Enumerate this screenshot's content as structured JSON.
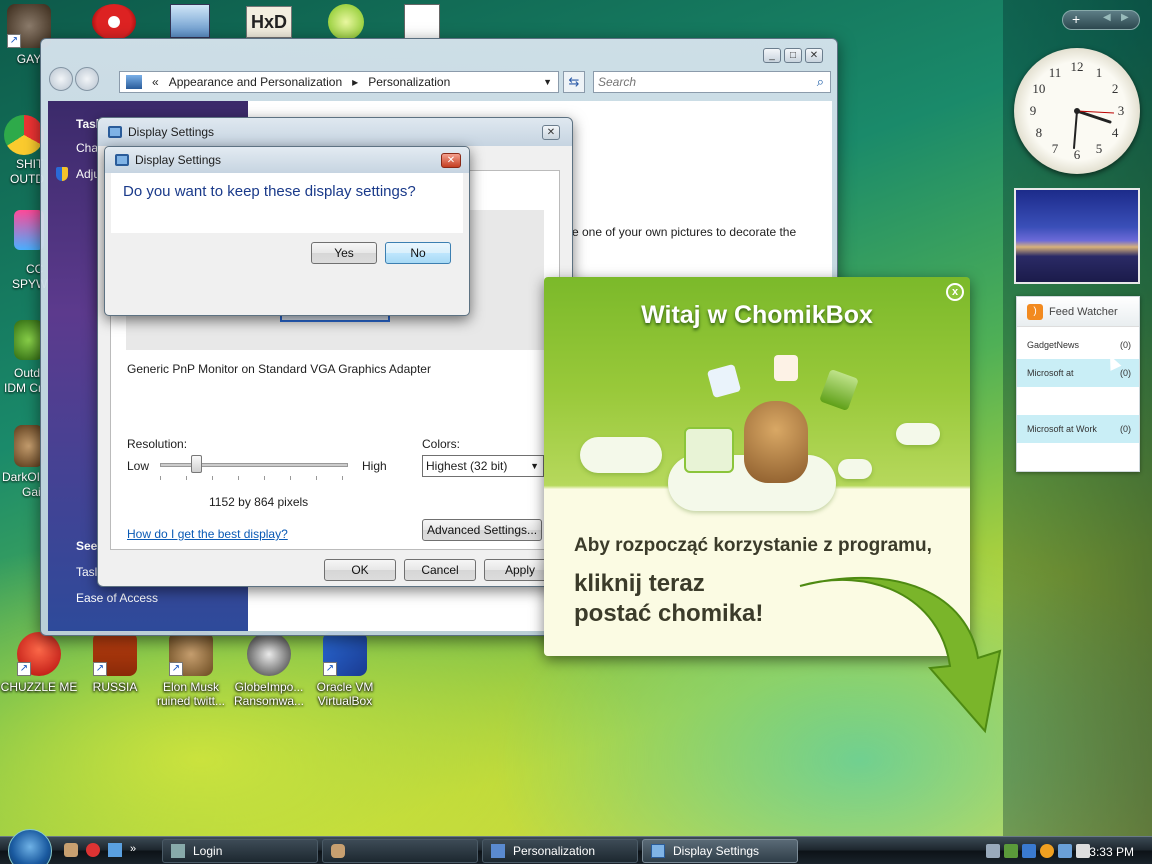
{
  "desktop": {
    "icons_partial": [
      {
        "label": "GAY"
      },
      {
        "label": "SHIT"
      },
      {
        "label": "OUTD"
      },
      {
        "label": "CC"
      },
      {
        "label": "SPYW"
      },
      {
        "label": "Outd"
      },
      {
        "label": "IDM Cr"
      },
      {
        "label": "DarkOI"
      },
      {
        "label": "Gai"
      }
    ],
    "icons_bottom": [
      {
        "label": "CHUZZLE ME"
      },
      {
        "label": "RUSSIA"
      },
      {
        "label": "Elon Musk ruined twitt..."
      },
      {
        "label": "GlobeImpo... Ransomwa..."
      },
      {
        "label": "Oracle VM VirtualBox"
      }
    ]
  },
  "personalization": {
    "address": {
      "chevron": "«",
      "crumb1": "Appearance and Personalization",
      "sep": "▸",
      "crumb2": "Personalization"
    },
    "search_placeholder": "Search",
    "left": {
      "tasks_heading": "Tasl",
      "task1": "Cha",
      "task2": "Adju",
      "see_also": "See",
      "see1": "Tasl",
      "see2": "Ease of Access"
    },
    "main_text": "e one of your own pictures to decorate the"
  },
  "display_settings": {
    "title": "Display Settings",
    "monitor_label": "Generic PnP Monitor on Standard VGA Graphics Adapter",
    "resolution_label": "Resolution:",
    "low": "Low",
    "high": "High",
    "resolution_value": "1152 by 864 pixels",
    "resolution_slider_fraction": 0.19,
    "colors_label": "Colors:",
    "colors_value": "Highest (32 bit)",
    "help_link": "How do I get the best display?",
    "advanced_btn": "Advanced Settings...",
    "ok": "OK",
    "cancel": "Cancel",
    "apply": "Apply"
  },
  "confirm_dialog": {
    "title": "Display Settings",
    "question": "Do you want to keep these display settings?",
    "yes": "Yes",
    "no": "No"
  },
  "chomikbox": {
    "title": "Witaj w ChomikBox",
    "line1": "Aby rozpocząć korzystanie z programu,",
    "line2a": "kliknij teraz",
    "line2b": "postać chomika!",
    "close": "x"
  },
  "sidebar": {
    "add": "+",
    "clock_numbers": [
      "12",
      "1",
      "2",
      "3",
      "4",
      "5",
      "6",
      "7",
      "8",
      "9",
      "10",
      "11"
    ],
    "feed": {
      "title": "Feed Watcher",
      "items": [
        {
          "name": "GadgetNews",
          "count": "(0)"
        },
        {
          "name": "Microsoft at",
          "count": "(0)"
        },
        {
          "name": "",
          "count": ""
        },
        {
          "name": "Microsoft at Work",
          "count": "(0)"
        }
      ]
    }
  },
  "taskbar": {
    "items": [
      {
        "label": "Login"
      },
      {
        "label": ""
      },
      {
        "label": "Personalization"
      },
      {
        "label": "Display Settings"
      }
    ],
    "time": "3:33 PM"
  }
}
